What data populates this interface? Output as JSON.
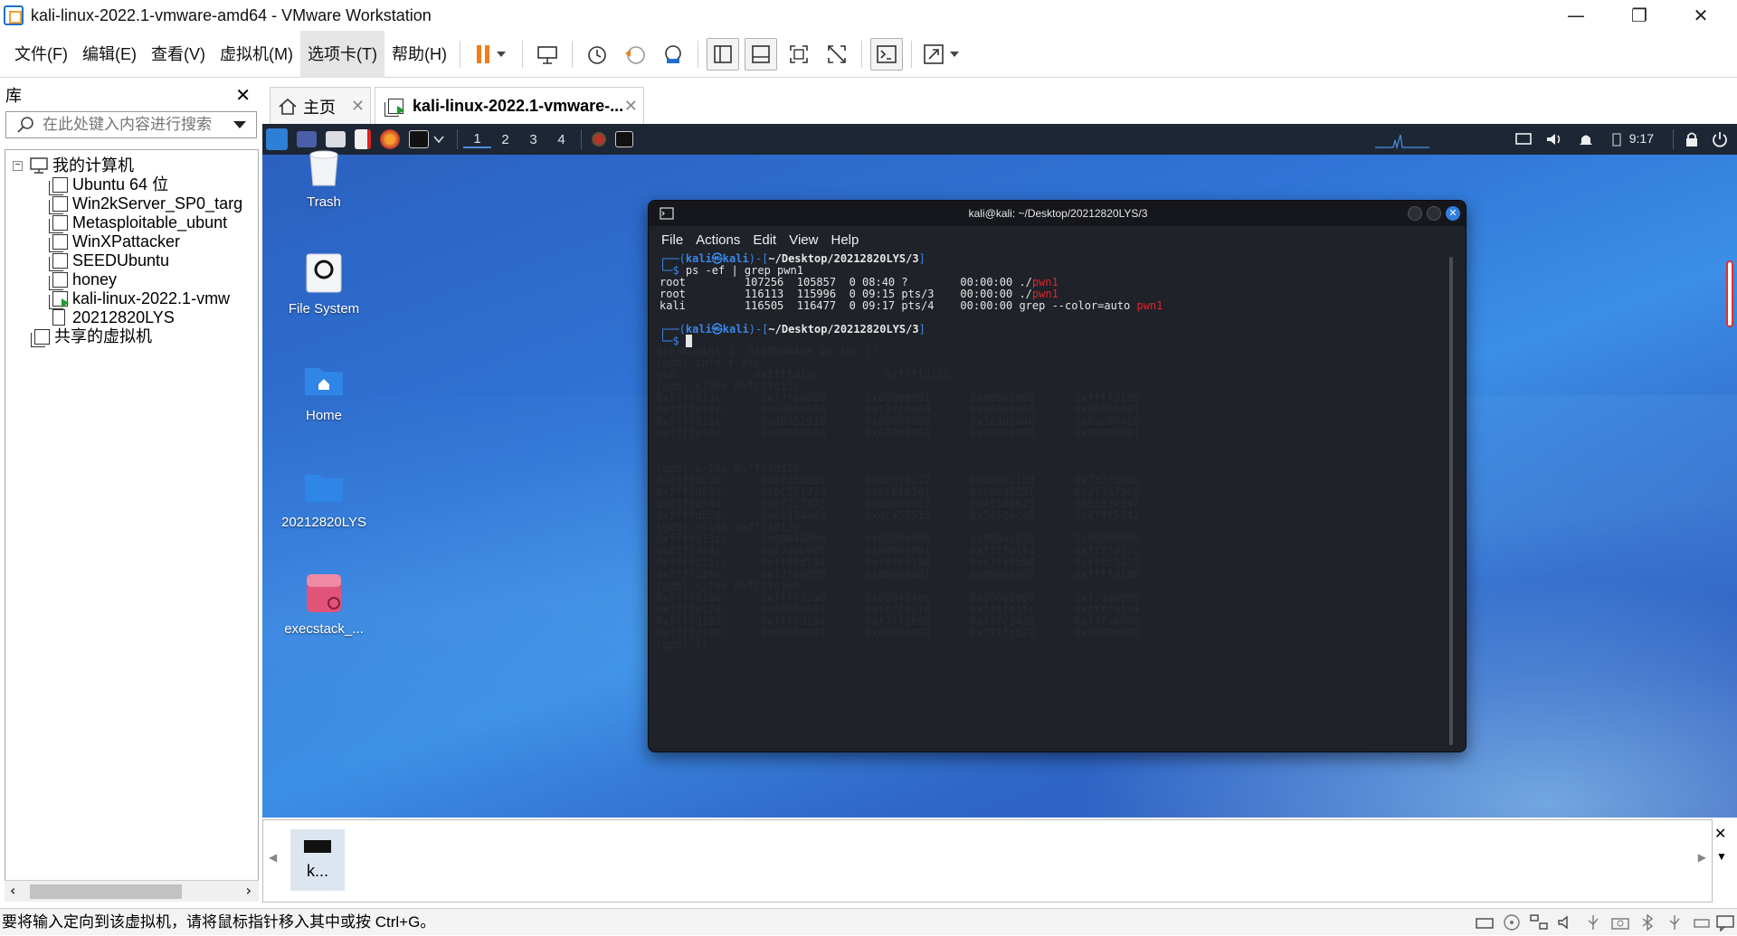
{
  "window": {
    "title": "kali-linux-2022.1-vmware-amd64 - VMware Workstation"
  },
  "menu": {
    "items": [
      "文件(F)",
      "编辑(E)",
      "查看(V)",
      "虚拟机(M)",
      "选项卡(T)",
      "帮助(H)"
    ]
  },
  "library": {
    "title": "库",
    "search_placeholder": "在此处键入内容进行搜索",
    "root": "我的计算机",
    "vms": [
      "Ubuntu 64 位",
      "Win2kServer_SP0_targ",
      "Metasploitable_ubunt",
      "WinXPattacker",
      "SEEDUbuntu",
      "honey",
      "kali-linux-2022.1-vmw",
      "20212820LYS"
    ],
    "shared": "共享的虚拟机"
  },
  "tabs": {
    "home": "主页",
    "vm": "kali-linux-2022.1-vmware-..."
  },
  "kali": {
    "workspaces": [
      "1",
      "2",
      "3",
      "4"
    ],
    "clock": "9:17",
    "desktop_icons": [
      "Trash",
      "File System",
      "Home",
      "20212820LYS",
      "execstack_..."
    ]
  },
  "terminal": {
    "title": "kali@kali: ~/Desktop/20212820LYS/3",
    "menu": [
      "File",
      "Actions",
      "Edit",
      "View",
      "Help"
    ],
    "prompt_user": "kali㉿kali",
    "prompt_path": "~/Desktop/20212820LYS/3",
    "command": "ps -ef | grep pwn1",
    "ps_rows": [
      {
        "user": "root",
        "pid": "107256",
        "ppid": "105857",
        "c": "0",
        "stime": "08:40",
        "tty": "?",
        "time": "00:00:00",
        "cmd": "./",
        "hl": "pwn1"
      },
      {
        "user": "root",
        "pid": "116113",
        "ppid": "115996",
        "c": "0",
        "stime": "09:15",
        "tty": "pts/3",
        "time": "00:00:00",
        "cmd": "./",
        "hl": "pwn1"
      },
      {
        "user": "kali",
        "pid": "116505",
        "ppid": "116477",
        "c": "0",
        "stime": "09:17",
        "tty": "pts/4",
        "time": "00:00:00",
        "cmd": "grep --color=auto ",
        "hl": "pwn1"
      }
    ]
  },
  "thumbnail": {
    "label": "k..."
  },
  "statusbar": {
    "text": "要将输入定向到该虚拟机，请将鼠标指针移入其中或按 Ctrl+G。"
  },
  "colors": {
    "accent": "#1e6fd0",
    "terminal_bg": "#1f2228",
    "prompt_blue": "#3a86e8",
    "highlight_red": "#e0242a"
  }
}
